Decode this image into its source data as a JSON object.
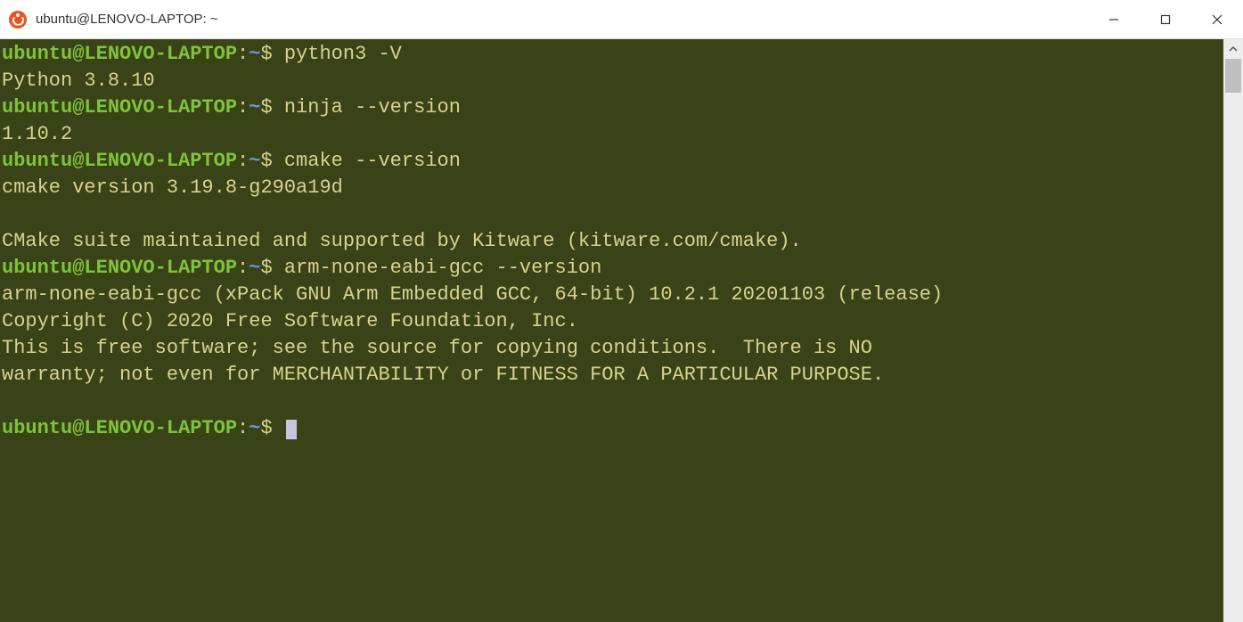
{
  "window": {
    "title": "ubuntu@LENOVO-LAPTOP: ~"
  },
  "prompt": {
    "user_host": "ubuntu@LENOVO-LAPTOP",
    "colon": ":",
    "path": "~",
    "dollar": "$"
  },
  "commands": {
    "c1": "python3 -V",
    "o1": "Python 3.8.10",
    "c2": "ninja --version",
    "o2": "1.10.2",
    "c3": "cmake --version",
    "o3a": "cmake version 3.19.8-g290a19d",
    "o3b": "",
    "o3c": "CMake suite maintained and supported by Kitware (kitware.com/cmake).",
    "c4": "arm-none-eabi-gcc --version",
    "o4a": "arm-none-eabi-gcc (xPack GNU Arm Embedded GCC, 64-bit) 10.2.1 20201103 (release)",
    "o4b": "Copyright (C) 2020 Free Software Foundation, Inc.",
    "o4c": "This is free software; see the source for copying conditions.  There is NO",
    "o4d": "warranty; not even for MERCHANTABILITY or FITNESS FOR A PARTICULAR PURPOSE.",
    "o4e": ""
  }
}
